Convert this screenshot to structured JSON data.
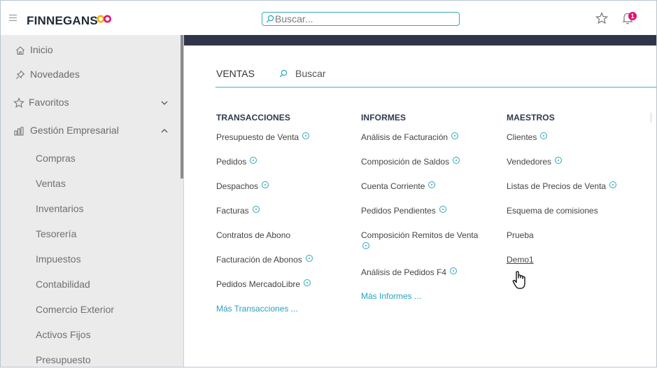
{
  "header": {
    "brand": "FINNEGANS",
    "search_placeholder": "Buscar...",
    "notification_count": "1",
    "brand_color": "#1f2a36",
    "logo_colors": [
      "#f4b400",
      "#e6106f"
    ]
  },
  "sidebar": {
    "top_items": [
      {
        "label": "Inicio",
        "icon": "home-icon"
      },
      {
        "label": "Novedades",
        "icon": "pin-icon"
      },
      {
        "label": "Favoritos",
        "icon": "star-icon",
        "chevron": "down"
      },
      {
        "label": "Gestión Empresarial",
        "icon": "chart-icon",
        "chevron": "up"
      }
    ],
    "sub_items": [
      "Compras",
      "Ventas",
      "Inventarios",
      "Tesorería",
      "Impuestos",
      "Contabilidad",
      "Comercio Exterior",
      "Activos Fijos",
      "Presupuesto"
    ]
  },
  "main": {
    "section_title": "VENTAS",
    "search_label": "Buscar",
    "accent_color": "#43b0c1",
    "columns": [
      {
        "title": "TRANSACCIONES",
        "items": [
          {
            "label": "Presupuesto de Venta",
            "help": true
          },
          {
            "label": "Pedidos",
            "help": true
          },
          {
            "label": "Despachos",
            "help": true
          },
          {
            "label": "Facturas",
            "help": true
          },
          {
            "label": "Contratos de Abono",
            "help": false
          },
          {
            "label": "Facturación de Abonos",
            "help": true
          },
          {
            "label": "Pedidos MercadoLibre",
            "help": true
          }
        ],
        "more": "Más Transacciones ..."
      },
      {
        "title": "INFORMES",
        "items": [
          {
            "label": "Análisis de Facturación",
            "help": true
          },
          {
            "label": "Composición de Saldos",
            "help": true
          },
          {
            "label": "Cuenta Corriente",
            "help": true
          },
          {
            "label": "Pedidos Pendientes",
            "help": true
          },
          {
            "label": "Composición Remitos de Venta",
            "help": true
          },
          {
            "label": "Análisis de Pedidos F4",
            "help": true
          }
        ],
        "more": "Más Informes ..."
      },
      {
        "title": "MAESTROS",
        "items": [
          {
            "label": "Clientes",
            "help": true
          },
          {
            "label": "Vendedores",
            "help": true
          },
          {
            "label": "Listas de Precios de Venta",
            "help": true
          },
          {
            "label": "Esquema de comisiones",
            "help": false
          },
          {
            "label": "Prueba",
            "help": false
          },
          {
            "label": "Demo1",
            "help": false
          }
        ]
      }
    ]
  }
}
